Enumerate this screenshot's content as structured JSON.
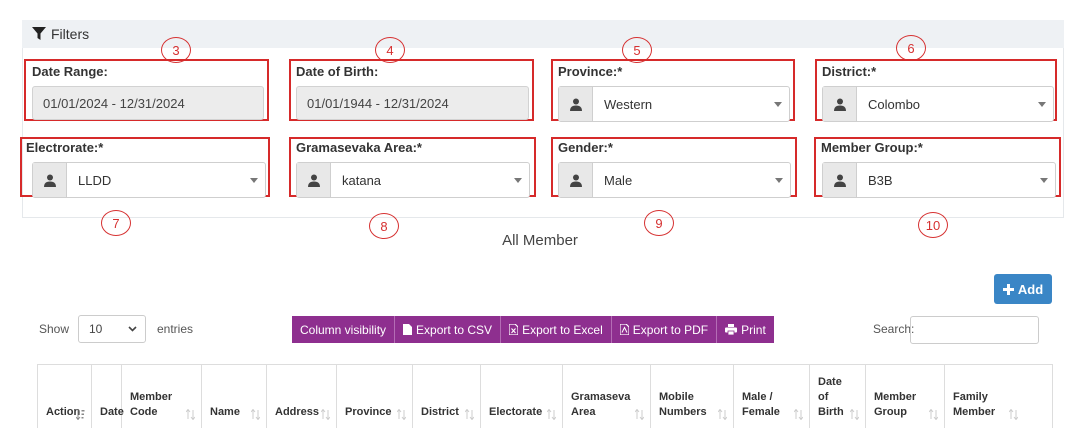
{
  "filters": {
    "title": "Filters",
    "date_range": {
      "label": "Date Range:",
      "value": "01/01/2024 - 12/31/2024"
    },
    "dob": {
      "label": "Date of Birth:",
      "value": "01/01/1944 - 12/31/2024"
    },
    "province": {
      "label": "Province:*",
      "value": "Western"
    },
    "district": {
      "label": "District:*",
      "value": "Colombo"
    },
    "electorate": {
      "label": "Electrorate:*",
      "value": "LLDD"
    },
    "gramasevaka": {
      "label": "Gramasevaka Area:*",
      "value": "katana"
    },
    "gender": {
      "label": "Gender:*",
      "value": "Male"
    },
    "member_group": {
      "label": "Member Group:*",
      "value": "B3B"
    }
  },
  "annotations": [
    "3",
    "4",
    "5",
    "6",
    "7",
    "8",
    "9",
    "10"
  ],
  "page_title": "All Member",
  "add_label": "Add",
  "length": {
    "show": "Show",
    "value": "10",
    "entries": "entries"
  },
  "buttons": [
    "Column visibility",
    "Export to CSV",
    "Export to Excel",
    "Export to PDF",
    "Print"
  ],
  "search_label": "Search:",
  "columns": [
    {
      "l1": "",
      "l2": "",
      "l3": "Action"
    },
    {
      "l1": "",
      "l2": "",
      "l3": "Date"
    },
    {
      "l1": "",
      "l2": "Member",
      "l3": "Code"
    },
    {
      "l1": "",
      "l2": "",
      "l3": "Name"
    },
    {
      "l1": "",
      "l2": "",
      "l3": "Address"
    },
    {
      "l1": "",
      "l2": "",
      "l3": "Province"
    },
    {
      "l1": "",
      "l2": "",
      "l3": "District"
    },
    {
      "l1": "",
      "l2": "",
      "l3": "Electorate"
    },
    {
      "l1": "",
      "l2": "Gramaseva",
      "l3": "Area"
    },
    {
      "l1": "",
      "l2": "Mobile",
      "l3": "Numbers"
    },
    {
      "l1": "",
      "l2": "Male /",
      "l3": "Female"
    },
    {
      "l1": "Date",
      "l2": "of",
      "l3": "Birth"
    },
    {
      "l1": "",
      "l2": "Member",
      "l3": "Group"
    },
    {
      "l1": "",
      "l2": "Family",
      "l3": "Member"
    }
  ],
  "colors": {
    "annotation_red": "#d62a2a",
    "add_blue": "#3a86c6",
    "export_purple": "#8e2f8f"
  }
}
